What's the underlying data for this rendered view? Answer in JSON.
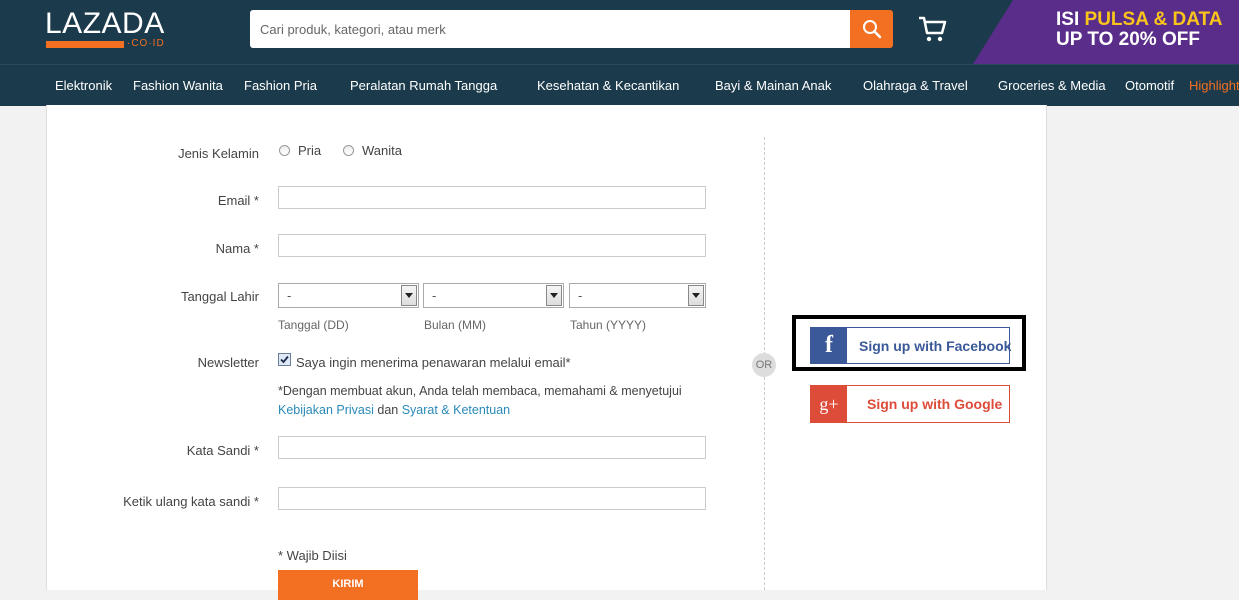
{
  "header": {
    "logo_text": "LAZADA",
    "logo_suffix": "·CO·ID",
    "search_placeholder": "Cari produk, kategori, atau merk",
    "promo_line1_a": "ISI ",
    "promo_line1_b": "PULSA & DATA",
    "promo_line2": "UP TO 20% OFF"
  },
  "nav": {
    "items": [
      "Elektronik",
      "Fashion Wanita",
      "Fashion Pria",
      "Peralatan Rumah Tangga",
      "Kesehatan & Kecantikan",
      "Bayi & Mainan Anak",
      "Olahraga & Travel",
      "Groceries & Media",
      "Otomotif",
      "Highlight"
    ]
  },
  "form": {
    "gender_label": "Jenis Kelamin",
    "gender_options": [
      "Pria",
      "Wanita"
    ],
    "email_label": "Email *",
    "name_label": "Nama *",
    "birthdate_label": "Tanggal Lahir",
    "birthdate_selects": [
      {
        "value": "-",
        "hint": "Tanggal (DD)"
      },
      {
        "value": "-",
        "hint": "Bulan (MM)"
      },
      {
        "value": "-",
        "hint": "Tahun (YYYY)"
      }
    ],
    "newsletter_label": "Newsletter",
    "newsletter_text": "Saya ingin menerima penawaran melalui email*",
    "consent_text": "*Dengan membuat akun, Anda telah membaca, memahami & menyetujui",
    "privacy_link": "Kebijakan Privasi",
    "and_text": " dan ",
    "terms_link": "Syarat & Ketentuan",
    "password_label": "Kata Sandi *",
    "password_confirm_label": "Ketik ulang kata sandi *",
    "required_note": "* Wajib Diisi",
    "submit_label": "KIRIM"
  },
  "social": {
    "or_label": "OR",
    "facebook_label": "Sign up with Facebook",
    "google_label": "Sign up with Google"
  },
  "colors": {
    "header_bg": "#1b3a4b",
    "accent": "#f36f21",
    "facebook": "#3b5998",
    "google": "#dd4b39"
  }
}
